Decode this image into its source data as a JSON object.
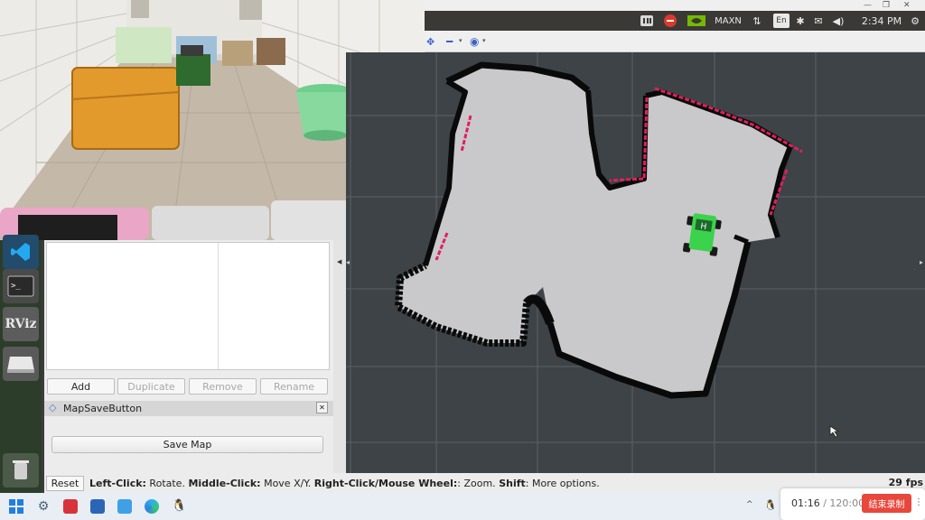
{
  "top_panel": {
    "indicators": [
      "MAXN",
      "En",
      "2:34 PM"
    ],
    "time": "2:34 PM",
    "power_mode": "MAXN",
    "keyboard_layout": "En"
  },
  "rviz": {
    "tree_panel": {
      "buttons": {
        "add": "Add",
        "duplicate": "Duplicate",
        "remove": "Remove",
        "rename": "Rename"
      }
    },
    "tool_panel": {
      "title": "MapSaveButton",
      "save_button": "Save Map"
    },
    "status_bar": {
      "reset": "Reset",
      "hint_parts": [
        {
          "text": "Left-Click:",
          "bold": true
        },
        {
          "text": " Rotate. ",
          "bold": false
        },
        {
          "text": "Middle-Click:",
          "bold": true
        },
        {
          "text": " Move X/Y. ",
          "bold": false
        },
        {
          "text": "Right-Click/Mouse Wheel:",
          "bold": true
        },
        {
          "text": ": Zoom. ",
          "bold": false
        },
        {
          "text": "Shift",
          "bold": true
        },
        {
          "text": ": More options.",
          "bold": false
        }
      ],
      "fps": "29 fps"
    },
    "launcher": {
      "items": [
        "vscode-icon",
        "terminal-icon",
        "rviz-icon",
        "disk-icon",
        "trash-icon"
      ],
      "rviz_label": "RViz"
    },
    "robot_label": "H"
  },
  "recorder": {
    "elapsed": "01:16",
    "separator": " / ",
    "total": "120:00",
    "stop_label": "结束录制"
  },
  "colors": {
    "map_free": "#c9c9cc",
    "map_wall": "#0a0a0a",
    "map_background": "#3d4347",
    "laser": "#e0205a",
    "robot": "#3cd34c",
    "panel": "#ececec",
    "launcher": "#2c3e2a",
    "record_button": "#e8483c"
  },
  "taskbar_icons": [
    "windows-start-icon",
    "settings-icon",
    "app-red-icon",
    "notes-icon",
    "explorer-icon",
    "edge-icon",
    "qq-icon"
  ]
}
